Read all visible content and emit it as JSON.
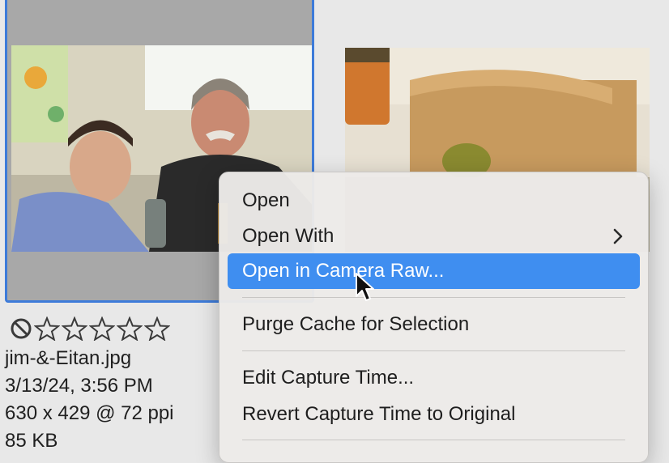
{
  "thumbnail_1": {
    "selected": true,
    "reject_icon": "no-entry-icon",
    "stars_total": 5,
    "stars_filled": 0,
    "filename": "jim-&-Eitan.jpg",
    "date": "3/13/24, 3:56 PM",
    "dimensions": "630 x 429 @ 72 ppi",
    "size": "85 KB"
  },
  "context_menu": {
    "items": [
      {
        "label": "Open"
      },
      {
        "label": "Open With",
        "submenu_icon": "chevron-right-icon"
      },
      {
        "label": "Open in Camera Raw...",
        "highlighted": true
      },
      {
        "label": "Purge Cache for Selection"
      },
      {
        "label": "Edit Capture Time..."
      },
      {
        "label": "Revert Capture Time to Original"
      }
    ]
  },
  "colors": {
    "selection_border": "#3d7bd9",
    "menu_highlight": "#3f8ef0",
    "background": "#e8e8e8"
  }
}
